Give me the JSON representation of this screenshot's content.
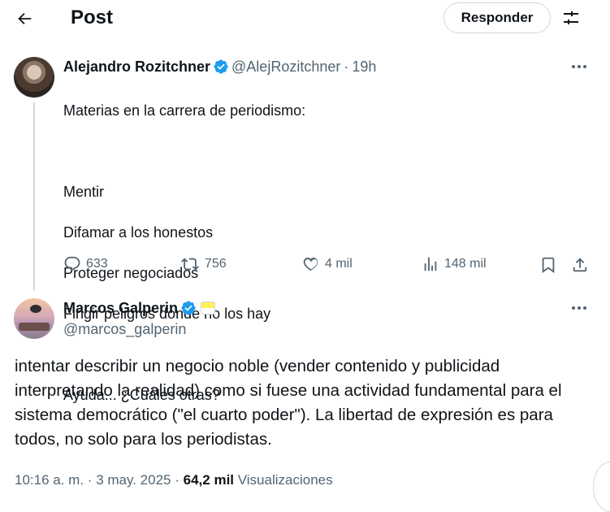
{
  "header": {
    "title": "Post",
    "reply_label": "Responder"
  },
  "parent_post": {
    "author_name": "Alejandro Rozitchner",
    "handle": "@AlejRozitchner",
    "separator": "·",
    "time": "19h",
    "lines": [
      "Materias en la carrera de periodismo:",
      "",
      "Mentir",
      "Difamar a los honestos",
      "Proteger negociados",
      "Fingir peligros donde no los hay",
      "",
      "Ayuda... ¿Cuáles otras?"
    ],
    "replies": "633",
    "reposts": "756",
    "likes": "4 mil",
    "views": "148 mil"
  },
  "main_post": {
    "author_name": "Marcos Galperin",
    "handle": "@marcos_galperin",
    "text": "intentar describir un negocio noble (vender contenido y publicidad interpretando la realidad) como si fuese una actividad fundamental para el sistema democrático (\"el cuarto poder\"). La libertad de expresión es para todos, no solo para los periodistas.",
    "time": "10:16 a. m.",
    "date": "3 may. 2025",
    "separator": "·",
    "views_count": "64,2 mil",
    "views_label": "Visualizaciones"
  },
  "colors": {
    "text": "#0f1419",
    "secondary": "#536471",
    "verified": "#1d9bf0",
    "border": "#cfd9de"
  }
}
